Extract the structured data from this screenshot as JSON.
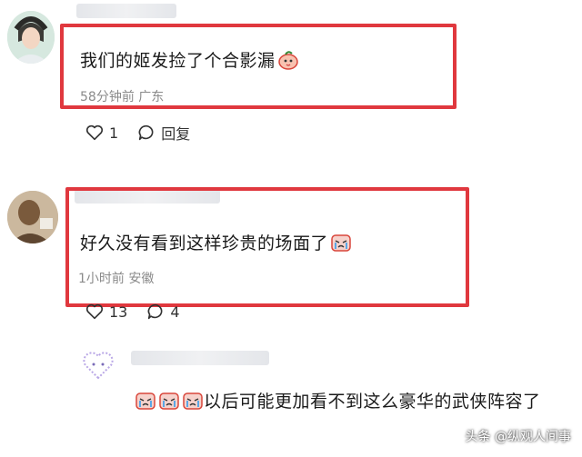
{
  "comments": [
    {
      "text": "我们的姬发捡了个合影漏",
      "meta": "58分钟前 广东",
      "like_count": "1",
      "reply_label": "回复"
    },
    {
      "text": "好久没有看到这样珍贵的场面了",
      "meta": "1小时前 安徽",
      "like_count": "13",
      "reply_count": "4"
    }
  ],
  "reply": {
    "text": "以后可能更加看不到这么豪华的武侠阵容了"
  },
  "watermark": "头条 @纵观人间事",
  "colors": {
    "highlight_box": "#e0383e",
    "meta_text": "#8a8a8a"
  }
}
